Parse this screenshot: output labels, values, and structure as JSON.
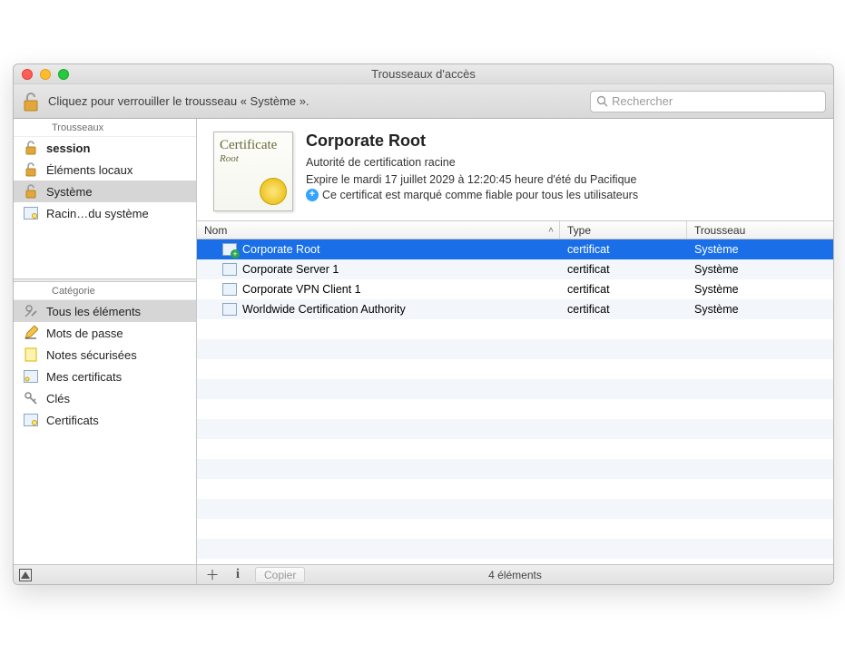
{
  "window": {
    "title": "Trousseaux d'accès"
  },
  "toolbar": {
    "lock_text": "Cliquez pour verrouiller le trousseau « Système ».",
    "search_placeholder": "Rechercher"
  },
  "sidebar": {
    "group_keychains": "Trousseaux",
    "keychains": [
      {
        "label": "session",
        "bold": true,
        "selected": false,
        "icon": "unlock"
      },
      {
        "label": "Éléments locaux",
        "bold": false,
        "selected": false,
        "icon": "unlock"
      },
      {
        "label": "Système",
        "bold": false,
        "selected": true,
        "icon": "unlock"
      },
      {
        "label": "Racin…du système",
        "bold": false,
        "selected": false,
        "icon": "cert"
      }
    ],
    "group_category": "Catégorie",
    "categories": [
      {
        "label": "Tous les éléments",
        "selected": true,
        "icon": "tools"
      },
      {
        "label": "Mots de passe",
        "selected": false,
        "icon": "pencil"
      },
      {
        "label": "Notes sécurisées",
        "selected": false,
        "icon": "note"
      },
      {
        "label": "Mes certificats",
        "selected": false,
        "icon": "mycert"
      },
      {
        "label": "Clés",
        "selected": false,
        "icon": "key"
      },
      {
        "label": "Certificats",
        "selected": false,
        "icon": "cert"
      }
    ]
  },
  "detail": {
    "title": "Corporate Root",
    "subtitle": "Autorité de certification racine",
    "expiry": "Expire le mardi 17 juillet 2029 à 12:20:45 heure d'été du Pacifique",
    "trust": "Ce certificat est marqué comme fiable pour tous les utilisateurs",
    "thumb_word1": "Certificate",
    "thumb_word2": "Root"
  },
  "table": {
    "columns": {
      "name": "Nom",
      "type": "Type",
      "keychain": "Trousseau"
    },
    "rows": [
      {
        "name": "Corporate Root",
        "type": "certificat",
        "keychain": "Système",
        "selected": true,
        "plus": true
      },
      {
        "name": "Corporate Server 1",
        "type": "certificat",
        "keychain": "Système",
        "selected": false,
        "plus": false
      },
      {
        "name": "Corporate VPN Client 1",
        "type": "certificat",
        "keychain": "Système",
        "selected": false,
        "plus": false
      },
      {
        "name": "Worldwide Certification Authority",
        "type": "certificat",
        "keychain": "Système",
        "selected": false,
        "plus": false
      }
    ]
  },
  "statusbar": {
    "copy": "Copier",
    "count": "4 éléments"
  }
}
